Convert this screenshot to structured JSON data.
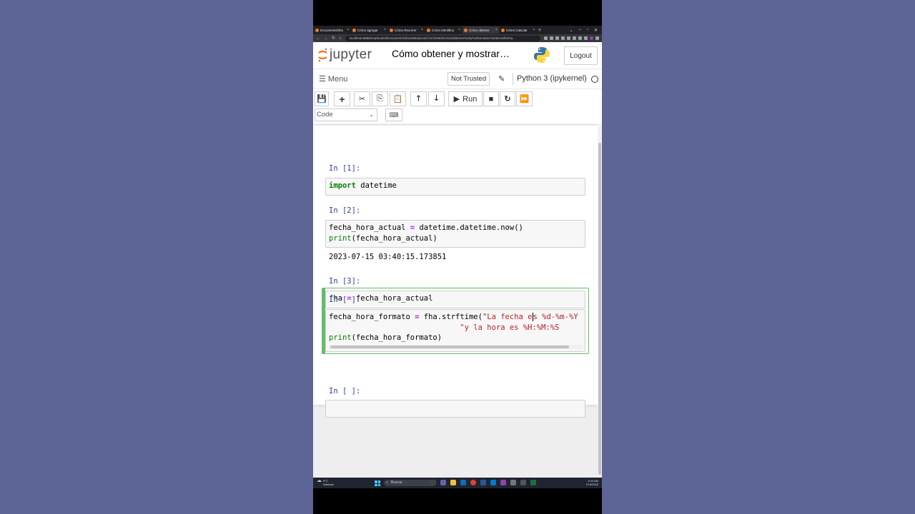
{
  "browser": {
    "tabs": [
      {
        "label": "Documents/Sho"
      },
      {
        "label": "Cómo agregar"
      },
      {
        "label": "Cómo Recorrer"
      },
      {
        "label": "Cómo identifica"
      },
      {
        "label": "Cómo obtener"
      },
      {
        "label": "Cómo Calcular"
      }
    ],
    "new_tab": "+",
    "url": "localhost:8888/notebooks/Documents/Shorts/Basicos/C%C3%B3mo%20obtener%20y%20mostrar%20la%20fecha..."
  },
  "jupyter": {
    "logo_text": "jupyter",
    "notebook_title": "Cómo obtener y mostrar…",
    "logout_label": "Logout",
    "menu_label": "Menu",
    "trust_label": "Not Trusted",
    "kernel_name": "Python 3 (ipykernel)",
    "run_label": "Run",
    "cell_type": "Code"
  },
  "cells": [
    {
      "prompt": "In [1]:"
    },
    {
      "prompt": "In [2]:",
      "output": "2023-07-15 03:40:15.173851"
    },
    {
      "prompt": "In [3]:"
    },
    {
      "prompt": "In [ ]:"
    },
    {
      "prompt": "In [ ]:"
    }
  ],
  "code": {
    "c1_kw": "import",
    "c1_rest": " datetime",
    "c2_l1a": "fecha_hora_actual ",
    "c2_l1op": "=",
    "c2_l1b": " datetime.datetime.now()",
    "c2_l2fn": "print",
    "c2_l2b": "(fecha_hora_actual)",
    "c3_a": "fha ",
    "c3_op": "=",
    "c3_b": " fecha_hora_actual",
    "c4_l1a": "fecha_hora_formato ",
    "c4_l1op": "=",
    "c4_l1b": " fha.strftime(",
    "c4_l1s1": "\"La fecha e",
    "c4_l1s2": "s %d-%m-%Y",
    "c4_l2pad": "                             ",
    "c4_l2s": "\"y la hora es %H:%M:%S",
    "c4_l3fn": "print",
    "c4_l3b": "(fecha_hora_formato)"
  },
  "taskbar": {
    "weather_temp": "9°C",
    "weather_desc": "Nublado",
    "search_label": "Buscar",
    "time": "3:40 AM",
    "date": "7/15/2023"
  },
  "colors": {
    "accent_jupyter": "#f37726",
    "prompt_blue": "#303f9f",
    "selected_cell": "#66bb6a",
    "background": "#5d6496"
  }
}
